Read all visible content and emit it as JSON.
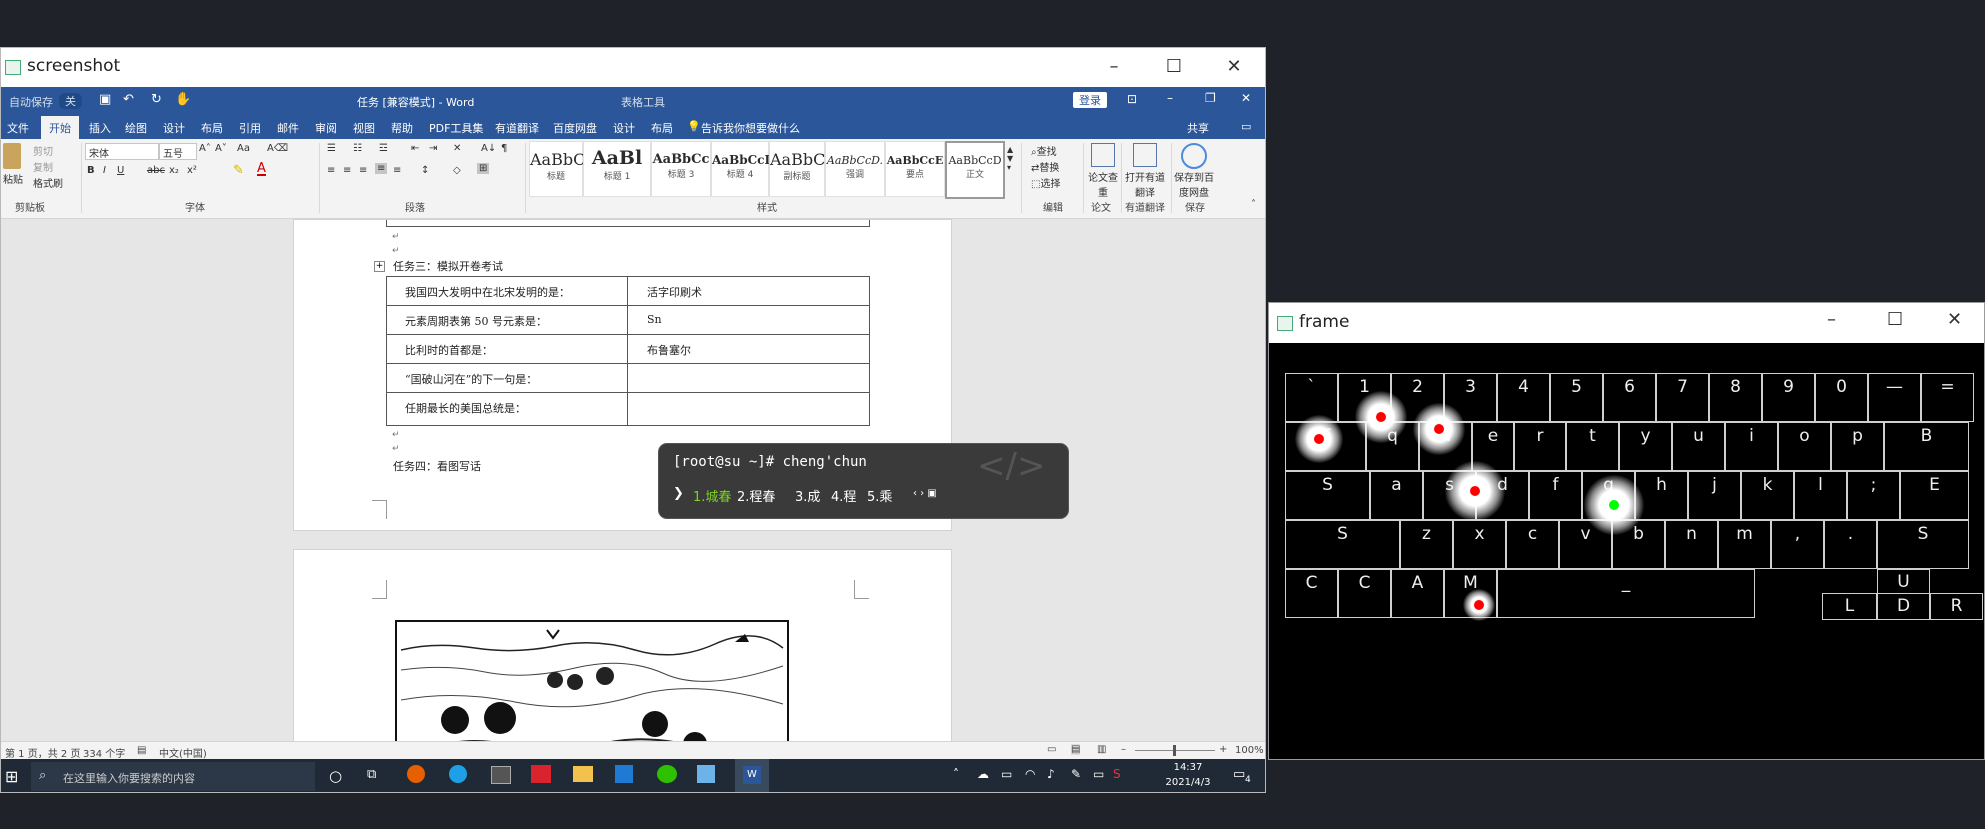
{
  "screenshot_window": {
    "title": "screenshot",
    "word": {
      "autosave": "自动保存",
      "autosave_state": "关",
      "doc_title": "任务 [兼容模式] - Word",
      "table_tools": "表格工具",
      "login_button": "登录",
      "tabs": [
        "文件",
        "开始",
        "插入",
        "绘图",
        "设计",
        "布局",
        "引用",
        "邮件",
        "审阅",
        "视图",
        "帮助",
        "PDF工具集",
        "有道翻译",
        "百度网盘",
        "设计",
        "布局"
      ],
      "tell_me": "告诉我你想要做什么",
      "share": "共享",
      "ribbon": {
        "clipboard": {
          "paste": "粘贴",
          "cut": "剪切",
          "copy": "复制",
          "format_painter": "格式刷",
          "group": "剪贴板"
        },
        "font": {
          "name": "宋体",
          "size": "五号",
          "group": "字体"
        },
        "paragraph": {
          "group": "段落"
        },
        "styles": {
          "group": "样式",
          "items": [
            {
              "sample": "AaBbC(",
              "name": "标题"
            },
            {
              "sample": "AaBl",
              "name": "标题 1"
            },
            {
              "sample": "AaBbCc",
              "name": "标题 3"
            },
            {
              "sample": "AaBbCcD",
              "name": "标题 4"
            },
            {
              "sample": "AaBbC(",
              "name": "副标题"
            },
            {
              "sample": "AaBbCcD.",
              "name": "强调"
            },
            {
              "sample": "AaBbCcE",
              "name": "要点"
            },
            {
              "sample": "AaBbCcD",
              "name": "正文"
            }
          ]
        },
        "editing": {
          "find": "查找",
          "replace": "替换",
          "select": "选择",
          "group": "编辑"
        },
        "paper": {
          "label": "论文查重",
          "group": "论文"
        },
        "youdao": {
          "label": "打开有道翻译",
          "group": "有道翻译"
        },
        "baidu": {
          "label": "保存到百度网盘",
          "group": "保存"
        }
      },
      "document": {
        "task3_heading": "任务三：模拟开卷考试",
        "table_rows": [
          {
            "q": "我国四大发明中在北宋发明的是：",
            "a": "活字印刷术"
          },
          {
            "q": "元素周期表第 50 号元素是：",
            "a": "Sn"
          },
          {
            "q": "比利时的首都是：",
            "a": "布鲁塞尔"
          },
          {
            "q": "“国破山河在”的下一句是：",
            "a": ""
          },
          {
            "q": "任期最长的美国总统是：",
            "a": ""
          }
        ],
        "task4_heading": "任务四：看图写话"
      },
      "statusbar": {
        "page": "第 1 页，共 2 页",
        "words": "334 个字",
        "lang": "中文(中国)",
        "zoom": "100%"
      }
    },
    "ime": {
      "input": "[root@su ~]# cheng'chun",
      "candidates": [
        "1.城春",
        "2.程春",
        "3.成",
        "4.程",
        "5.乘"
      ]
    },
    "taskbar": {
      "search_placeholder": "在这里输入你要搜索的内容",
      "time": "14:37",
      "date": "2021/4/3",
      "notification_count": "4"
    }
  },
  "frame_window": {
    "title": "frame",
    "keyboard_rows": [
      [
        "`",
        "1",
        "2",
        "3",
        "4",
        "5",
        "6",
        "7",
        "8",
        "9",
        "0",
        "—",
        "="
      ],
      [
        "T",
        "q",
        "w",
        "e",
        "r",
        "t",
        "y",
        "u",
        "i",
        "o",
        "p",
        "B"
      ],
      [
        "S",
        "a",
        "s",
        "d",
        "f",
        "g",
        "h",
        "j",
        "k",
        "l",
        ";",
        "E"
      ],
      [
        "S",
        "z",
        "x",
        "c",
        "v",
        "b",
        "n",
        "m",
        ",",
        ".",
        "S"
      ],
      [
        "C",
        "C",
        "A",
        "M",
        "_",
        "U"
      ],
      [
        "L",
        "D",
        "R"
      ]
    ],
    "colors": {
      "fingertip": "#ff0000",
      "active_fingertip": "#00ff00"
    }
  }
}
